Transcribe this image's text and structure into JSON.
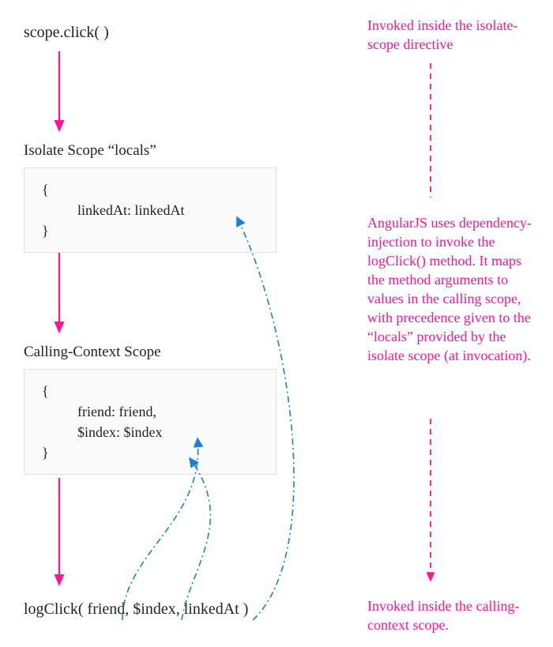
{
  "step1": "scope.click( )",
  "label_locals": "Isolate Scope “locals”",
  "locals_box": {
    "brace_open": "{",
    "prop1": "linkedAt: linkedAt",
    "brace_close": "}"
  },
  "label_context": "Calling-Context Scope",
  "context_box": {
    "brace_open": "{",
    "prop1": "friend: friend,",
    "prop2": "$index: $index",
    "brace_close": "}"
  },
  "final_call": "logClick( friend, $index, linkedAt )",
  "note_top": "Invoked inside the isolate-scope directive",
  "note_mid": "AngularJS uses dependency-injection to invoke the logClick() method. It maps the method arguments to values in the calling scope, with precedence given to the “locals” provided by the isolate scope (at invocation).",
  "note_bottom": "Invoked inside the calling-context scope.",
  "colors": {
    "pink": "#ff1493",
    "blue": "#1e7fd6",
    "box_border": "#e0e0e0",
    "box_bg": "#fafafa"
  }
}
